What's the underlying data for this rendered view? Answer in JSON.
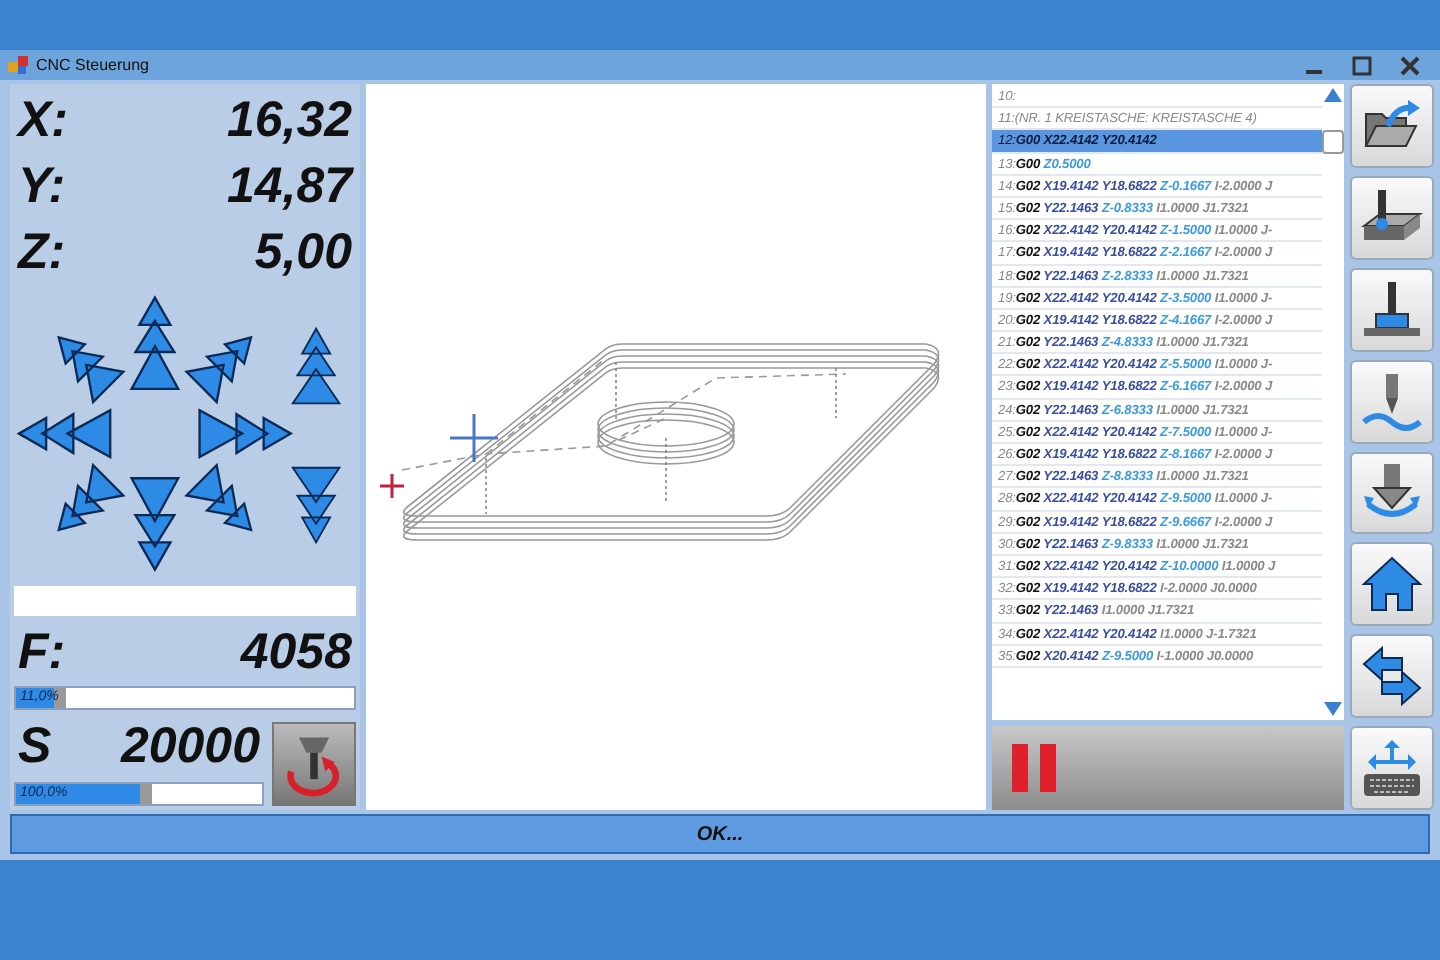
{
  "window": {
    "title": "CNC Steuerung"
  },
  "position": [
    {
      "axis": "X:",
      "value": "16,32"
    },
    {
      "axis": "Y:",
      "value": "14,87"
    },
    {
      "axis": "Z:",
      "value": "5,00"
    }
  ],
  "feed": {
    "label": "F:",
    "value": "4058",
    "slider": {
      "level": 0.11,
      "reading": "11,0%"
    }
  },
  "spindle": {
    "label": "S",
    "value": "20000",
    "slider": {
      "level": 0.5,
      "reading": "100,0%"
    }
  },
  "program": {
    "lines": [
      {
        "num": "10:",
        "selected": false
      },
      {
        "num": "11:",
        "selected": false,
        "parts": [
          {
            "kind": "comment",
            "text": "(NR. 1 KREISTASCHE: KREISTASCHE 4)"
          }
        ]
      },
      {
        "num": "12:",
        "selected": true,
        "parts": [
          {
            "kind": "g",
            "text": "G00"
          },
          {
            "kind": "xy",
            "text": "X22.4142"
          },
          {
            "kind": "xy",
            "text": "Y20.4142"
          }
        ]
      },
      {
        "num": "13:",
        "selected": false,
        "parts": [
          {
            "kind": "g",
            "text": "G00"
          },
          {
            "kind": "z",
            "text": "Z0.5000"
          }
        ]
      },
      {
        "num": "14:",
        "selected": false,
        "parts": [
          {
            "kind": "g",
            "text": "G02"
          },
          {
            "kind": "xy",
            "text": "X19.4142"
          },
          {
            "kind": "xy",
            "text": "Y18.6822"
          },
          {
            "kind": "z",
            "text": "Z-0.1667"
          },
          {
            "kind": "ij",
            "text": "I-2.0000 J"
          }
        ]
      },
      {
        "num": "15:",
        "selected": false,
        "parts": [
          {
            "kind": "g",
            "text": "G02"
          },
          {
            "kind": "xy",
            "text": "Y22.1463"
          },
          {
            "kind": "z",
            "text": "Z-0.8333"
          },
          {
            "kind": "ij",
            "text": "I1.0000 J1.7321"
          }
        ]
      },
      {
        "num": "16:",
        "selected": false,
        "parts": [
          {
            "kind": "g",
            "text": "G02"
          },
          {
            "kind": "xy",
            "text": "X22.4142"
          },
          {
            "kind": "xy",
            "text": "Y20.4142"
          },
          {
            "kind": "z",
            "text": "Z-1.5000"
          },
          {
            "kind": "ij",
            "text": "I1.0000 J-"
          }
        ]
      },
      {
        "num": "17:",
        "selected": false,
        "parts": [
          {
            "kind": "g",
            "text": "G02"
          },
          {
            "kind": "xy",
            "text": "X19.4142"
          },
          {
            "kind": "xy",
            "text": "Y18.6822"
          },
          {
            "kind": "z",
            "text": "Z-2.1667"
          },
          {
            "kind": "ij",
            "text": "I-2.0000 J"
          }
        ]
      },
      {
        "num": "18:",
        "selected": false,
        "parts": [
          {
            "kind": "g",
            "text": "G02"
          },
          {
            "kind": "xy",
            "text": "Y22.1463"
          },
          {
            "kind": "z",
            "text": "Z-2.8333"
          },
          {
            "kind": "ij",
            "text": "I1.0000 J1.7321"
          }
        ]
      },
      {
        "num": "19:",
        "selected": false,
        "parts": [
          {
            "kind": "g",
            "text": "G02"
          },
          {
            "kind": "xy",
            "text": "X22.4142"
          },
          {
            "kind": "xy",
            "text": "Y20.4142"
          },
          {
            "kind": "z",
            "text": "Z-3.5000"
          },
          {
            "kind": "ij",
            "text": "I1.0000 J-"
          }
        ]
      },
      {
        "num": "20:",
        "selected": false,
        "parts": [
          {
            "kind": "g",
            "text": "G02"
          },
          {
            "kind": "xy",
            "text": "X19.4142"
          },
          {
            "kind": "xy",
            "text": "Y18.6822"
          },
          {
            "kind": "z",
            "text": "Z-4.1667"
          },
          {
            "kind": "ij",
            "text": "I-2.0000 J"
          }
        ]
      },
      {
        "num": "21:",
        "selected": false,
        "parts": [
          {
            "kind": "g",
            "text": "G02"
          },
          {
            "kind": "xy",
            "text": "Y22.1463"
          },
          {
            "kind": "z",
            "text": "Z-4.8333"
          },
          {
            "kind": "ij",
            "text": "I1.0000 J1.7321"
          }
        ]
      },
      {
        "num": "22:",
        "selected": false,
        "parts": [
          {
            "kind": "g",
            "text": "G02"
          },
          {
            "kind": "xy",
            "text": "X22.4142"
          },
          {
            "kind": "xy",
            "text": "Y20.4142"
          },
          {
            "kind": "z",
            "text": "Z-5.5000"
          },
          {
            "kind": "ij",
            "text": "I1.0000 J-"
          }
        ]
      },
      {
        "num": "23:",
        "selected": false,
        "parts": [
          {
            "kind": "g",
            "text": "G02"
          },
          {
            "kind": "xy",
            "text": "X19.4142"
          },
          {
            "kind": "xy",
            "text": "Y18.6822"
          },
          {
            "kind": "z",
            "text": "Z-6.1667"
          },
          {
            "kind": "ij",
            "text": "I-2.0000 J"
          }
        ]
      },
      {
        "num": "24:",
        "selected": false,
        "parts": [
          {
            "kind": "g",
            "text": "G02"
          },
          {
            "kind": "xy",
            "text": "Y22.1463"
          },
          {
            "kind": "z",
            "text": "Z-6.8333"
          },
          {
            "kind": "ij",
            "text": "I1.0000 J1.7321"
          }
        ]
      },
      {
        "num": "25:",
        "selected": false,
        "parts": [
          {
            "kind": "g",
            "text": "G02"
          },
          {
            "kind": "xy",
            "text": "X22.4142"
          },
          {
            "kind": "xy",
            "text": "Y20.4142"
          },
          {
            "kind": "z",
            "text": "Z-7.5000"
          },
          {
            "kind": "ij",
            "text": "I1.0000 J-"
          }
        ]
      },
      {
        "num": "26:",
        "selected": false,
        "parts": [
          {
            "kind": "g",
            "text": "G02"
          },
          {
            "kind": "xy",
            "text": "X19.4142"
          },
          {
            "kind": "xy",
            "text": "Y18.6822"
          },
          {
            "kind": "z",
            "text": "Z-8.1667"
          },
          {
            "kind": "ij",
            "text": "I-2.0000 J"
          }
        ]
      },
      {
        "num": "27:",
        "selected": false,
        "parts": [
          {
            "kind": "g",
            "text": "G02"
          },
          {
            "kind": "xy",
            "text": "Y22.1463"
          },
          {
            "kind": "z",
            "text": "Z-8.8333"
          },
          {
            "kind": "ij",
            "text": "I1.0000 J1.7321"
          }
        ]
      },
      {
        "num": "28:",
        "selected": false,
        "parts": [
          {
            "kind": "g",
            "text": "G02"
          },
          {
            "kind": "xy",
            "text": "X22.4142"
          },
          {
            "kind": "xy",
            "text": "Y20.4142"
          },
          {
            "kind": "z",
            "text": "Z-9.5000"
          },
          {
            "kind": "ij",
            "text": "I1.0000 J-"
          }
        ]
      },
      {
        "num": "29:",
        "selected": false,
        "parts": [
          {
            "kind": "g",
            "text": "G02"
          },
          {
            "kind": "xy",
            "text": "X19.4142"
          },
          {
            "kind": "xy",
            "text": "Y18.6822"
          },
          {
            "kind": "z",
            "text": "Z-9.6667"
          },
          {
            "kind": "ij",
            "text": "I-2.0000 J"
          }
        ]
      },
      {
        "num": "30:",
        "selected": false,
        "parts": [
          {
            "kind": "g",
            "text": "G02"
          },
          {
            "kind": "xy",
            "text": "Y22.1463"
          },
          {
            "kind": "z",
            "text": "Z-9.8333"
          },
          {
            "kind": "ij",
            "text": "I1.0000 J1.7321"
          }
        ]
      },
      {
        "num": "31:",
        "selected": false,
        "parts": [
          {
            "kind": "g",
            "text": "G02"
          },
          {
            "kind": "xy",
            "text": "X22.4142"
          },
          {
            "kind": "xy",
            "text": "Y20.4142"
          },
          {
            "kind": "z",
            "text": "Z-10.0000"
          },
          {
            "kind": "ij",
            "text": "I1.0000 J"
          }
        ]
      },
      {
        "num": "32:",
        "selected": false,
        "parts": [
          {
            "kind": "g",
            "text": "G02"
          },
          {
            "kind": "xy",
            "text": "X19.4142"
          },
          {
            "kind": "xy",
            "text": "Y18.6822"
          },
          {
            "kind": "ij",
            "text": "I-2.0000 J0.0000"
          }
        ]
      },
      {
        "num": "33:",
        "selected": false,
        "parts": [
          {
            "kind": "g",
            "text": "G02"
          },
          {
            "kind": "xy",
            "text": "Y22.1463"
          },
          {
            "kind": "ij",
            "text": "I1.0000 J1.7321"
          }
        ]
      },
      {
        "num": "34:",
        "selected": false,
        "parts": [
          {
            "kind": "g",
            "text": "G02"
          },
          {
            "kind": "xy",
            "text": "X22.4142"
          },
          {
            "kind": "xy",
            "text": "Y20.4142"
          },
          {
            "kind": "ij",
            "text": "I1.0000 J-1.7321"
          }
        ]
      },
      {
        "num": "35:",
        "selected": false,
        "parts": [
          {
            "kind": "g",
            "text": "G02"
          },
          {
            "kind": "xy",
            "text": "X20.4142"
          },
          {
            "kind": "z",
            "text": "Z-9.5000"
          },
          {
            "kind": "ij",
            "text": "I-1.0000 J0.0000"
          }
        ]
      }
    ]
  },
  "ok_button": {
    "label": "OK..."
  }
}
